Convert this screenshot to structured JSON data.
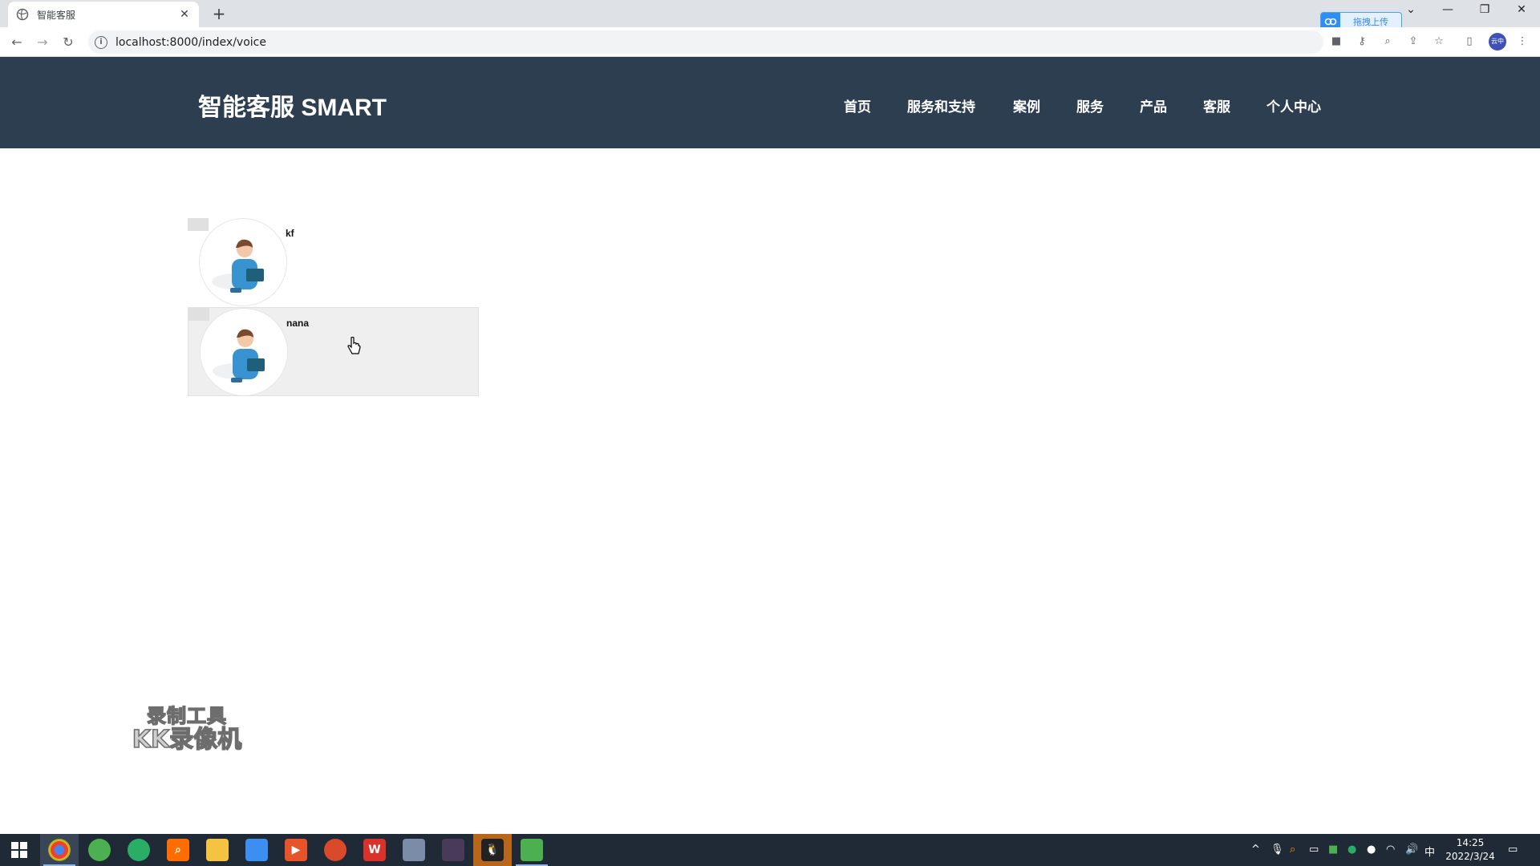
{
  "browser": {
    "tab_title": "智能客服",
    "url": "localhost:8000/index/voice",
    "upload_label": "拖拽上传",
    "profile_label": "云中"
  },
  "site": {
    "brand": "智能客服 SMART",
    "nav": [
      "首页",
      "服务和支持",
      "案例",
      "服务",
      "产品",
      "客服",
      "个人中心"
    ]
  },
  "contacts": [
    {
      "name": "kf"
    },
    {
      "name": "nana"
    }
  ],
  "watermark": {
    "line1": "录制工具",
    "line2": "KK录像机"
  },
  "taskbar": {
    "time": "14:25",
    "date": "2022/3/24",
    "ime": "中"
  },
  "colors": {
    "header_bg": "#2c3e50",
    "hover_bg": "#efefef"
  }
}
